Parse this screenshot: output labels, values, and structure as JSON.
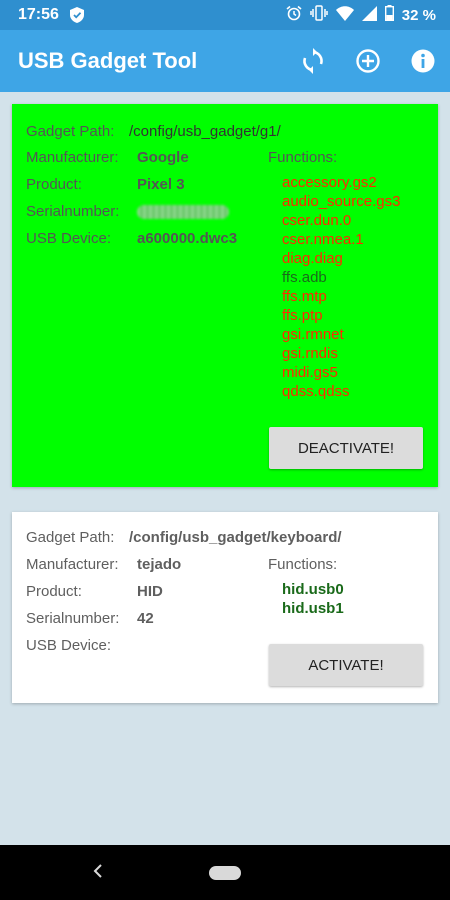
{
  "status_bar": {
    "time": "17:56",
    "battery": "32 %",
    "icons": [
      "shield-icon",
      "alarm-icon",
      "vibrate-icon",
      "wifi-icon",
      "signal-icon",
      "battery-icon"
    ]
  },
  "app_bar": {
    "title": "USB Gadget Tool",
    "actions": [
      "refresh-icon",
      "add-icon",
      "info-icon"
    ]
  },
  "gadgets": [
    {
      "state": "active",
      "background": "#00ff00",
      "path_label": "Gadget Path:",
      "path": "/config/usb_gadget/g1/",
      "manufacturer_label": "Manufacturer:",
      "manufacturer": "Google",
      "product_label": "Product:",
      "product": "Pixel 3",
      "serial_label": "Serialnumber:",
      "serial_blurred": true,
      "usb_device_label": "USB Device:",
      "usb_device": "a600000.dwc3",
      "functions_label": "Functions:",
      "functions": [
        {
          "name": "accessory.gs2",
          "color": "#ff2a00"
        },
        {
          "name": "audio_source.gs3",
          "color": "#ff2a00"
        },
        {
          "name": "cser.dun.0",
          "color": "#ff2a00"
        },
        {
          "name": "cser.nmea.1",
          "color": "#ff2a00"
        },
        {
          "name": "diag.diag",
          "color": "#ff2a00"
        },
        {
          "name": "ffs.adb",
          "color": "#1a6a1a"
        },
        {
          "name": "ffs.mtp",
          "color": "#ff2a00"
        },
        {
          "name": "ffs.ptp",
          "color": "#ff2a00"
        },
        {
          "name": "gsi.rmnet",
          "color": "#ff2a00"
        },
        {
          "name": "gsi.rndis",
          "color": "#ff2a00"
        },
        {
          "name": "midi.gs5",
          "color": "#ff2a00"
        },
        {
          "name": "qdss.qdss",
          "color": "#ff2a00"
        }
      ],
      "button_label": "DEACTIVATE!"
    },
    {
      "state": "inactive",
      "background": "#ffffff",
      "path_label": "Gadget Path:",
      "path": "/config/usb_gadget/keyboard/",
      "manufacturer_label": "Manufacturer:",
      "manufacturer": "tejado",
      "product_label": "Product:",
      "product": "HID",
      "serial_label": "Serialnumber:",
      "serial": "42",
      "usb_device_label": "USB Device:",
      "usb_device": "",
      "functions_label": "Functions:",
      "functions": [
        {
          "name": "hid.usb0",
          "color": "#1a6a1a"
        },
        {
          "name": "hid.usb1",
          "color": "#1a6a1a"
        }
      ],
      "button_label": "ACTIVATE!"
    }
  ],
  "nav_bar": {
    "buttons": [
      "back-icon",
      "home-icon"
    ]
  }
}
